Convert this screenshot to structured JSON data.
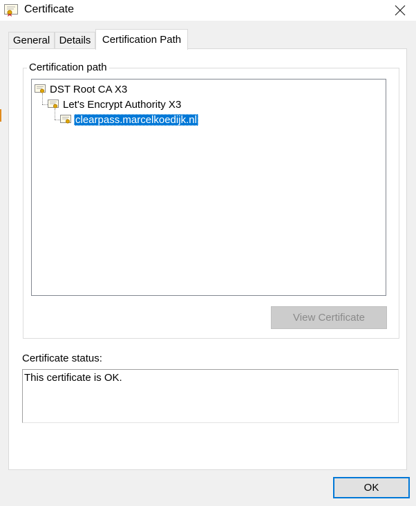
{
  "window": {
    "title": "Certificate"
  },
  "tabs": [
    {
      "label": "General"
    },
    {
      "label": "Details"
    },
    {
      "label": "Certification Path"
    }
  ],
  "certification_path": {
    "group_label": "Certification path",
    "nodes": [
      {
        "label": "DST Root CA X3"
      },
      {
        "label": "Let's Encrypt Authority X3"
      },
      {
        "label": "clearpass.marcelkoedijk.nl"
      }
    ],
    "view_button_label": "View Certificate"
  },
  "status": {
    "label": "Certificate status:",
    "text": "This certificate is OK."
  },
  "footer": {
    "ok_label": "OK"
  },
  "colors": {
    "selection": "#0078d7",
    "accent": "#0078d7"
  }
}
